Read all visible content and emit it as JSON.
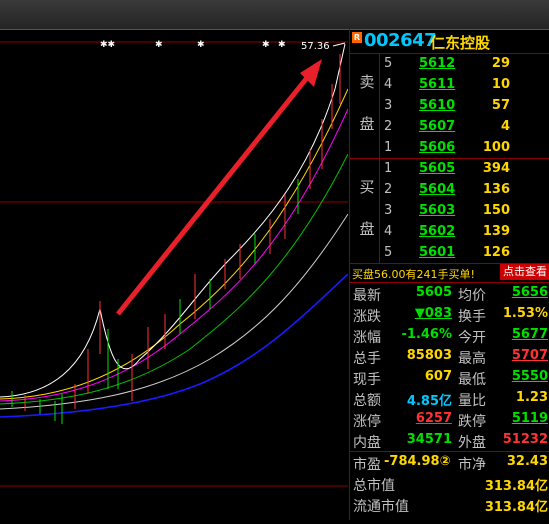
{
  "chart": {
    "price_label": "57.36"
  },
  "quote": {
    "badge": "R",
    "code": "002647",
    "name": "仁东控股",
    "sell_label": [
      "卖",
      "盘"
    ],
    "buy_label": [
      "买",
      "盘"
    ],
    "sell": [
      {
        "level": "5",
        "price": "5612",
        "qty": "29"
      },
      {
        "level": "4",
        "price": "5611",
        "qty": "10"
      },
      {
        "level": "3",
        "price": "5610",
        "qty": "57"
      },
      {
        "level": "2",
        "price": "5607",
        "qty": "4"
      },
      {
        "level": "1",
        "price": "5606",
        "qty": "100"
      }
    ],
    "buy": [
      {
        "level": "1",
        "price": "5605",
        "qty": "394"
      },
      {
        "level": "2",
        "price": "5604",
        "qty": "136"
      },
      {
        "level": "3",
        "price": "5603",
        "qty": "150"
      },
      {
        "level": "4",
        "price": "5602",
        "qty": "139"
      },
      {
        "level": "5",
        "price": "5601",
        "qty": "126"
      }
    ],
    "note": "买盘56.00有241手买单!",
    "note_button": "点击查看",
    "stats": [
      {
        "k1": "最新",
        "v1": "5605",
        "c1": "#00e000",
        "k2": "均价",
        "v2": "5656",
        "c2": "#00e000"
      },
      {
        "k1": "涨跌",
        "v1": "▼083",
        "c1": "#00e000",
        "k2": "换手",
        "v2": "1.53%",
        "c2": "#ffd700"
      },
      {
        "k1": "涨幅",
        "v1": "-1.46%",
        "c1": "#00e000",
        "k2": "今开",
        "v2": "5677",
        "c2": "#00e000"
      },
      {
        "k1": "总手",
        "v1": "85803",
        "c1": "#ffd700",
        "k2": "最高",
        "v2": "5707",
        "c2": "#ff3333"
      },
      {
        "k1": "现手",
        "v1": "607",
        "c1": "#ffd700",
        "k2": "最低",
        "v2": "5550",
        "c2": "#00e000"
      },
      {
        "k1": "总额",
        "v1": "4.85亿",
        "c1": "#00c8ff",
        "k2": "量比",
        "v2": "1.23",
        "c2": "#ffd700"
      },
      {
        "k1": "涨停",
        "v1": "6257",
        "c1": "#ff3333",
        "k2": "跌停",
        "v2": "5119",
        "c2": "#00e000"
      },
      {
        "k1": "内盘",
        "v1": "34571",
        "c1": "#00e000",
        "k2": "外盘",
        "v2": "51232",
        "c2": "#ff3333"
      }
    ],
    "pe_label": "市盈",
    "pe": "-784.98②",
    "pb_label": "市净",
    "pb": "32.43",
    "mcap_label": "总市值",
    "mcap": "313.84亿",
    "float_label": "流通市值",
    "float": "313.84亿"
  }
}
